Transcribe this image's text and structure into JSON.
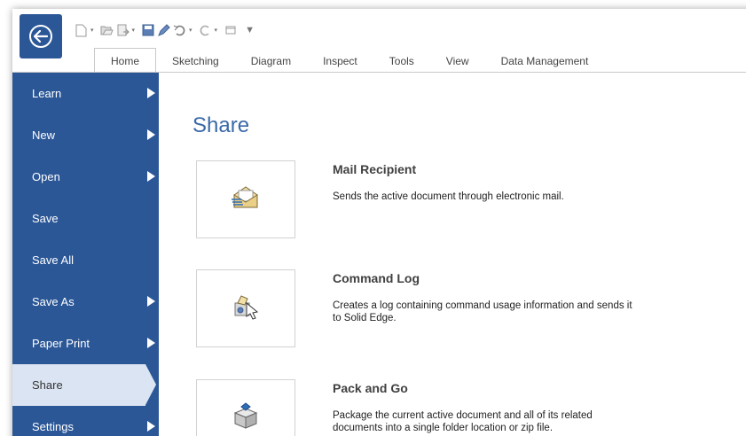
{
  "quick_access": {
    "icons": [
      "new-icon",
      "open-icon",
      "send-icon",
      "save-icon",
      "edit-icon",
      "undo-icon",
      "redo-icon",
      "window-icon",
      "customize-icon"
    ]
  },
  "ribbon": {
    "tabs": [
      {
        "label": "Home",
        "active": true
      },
      {
        "label": "Sketching",
        "active": false
      },
      {
        "label": "Diagram",
        "active": false
      },
      {
        "label": "Inspect",
        "active": false
      },
      {
        "label": "Tools",
        "active": false
      },
      {
        "label": "View",
        "active": false
      },
      {
        "label": "Data Management",
        "active": false
      }
    ]
  },
  "sidebar": {
    "items": [
      {
        "label": "Learn",
        "has_arrow": true
      },
      {
        "label": "New",
        "has_arrow": true
      },
      {
        "label": "Open",
        "has_arrow": true
      },
      {
        "label": "Save",
        "has_arrow": false
      },
      {
        "label": "Save All",
        "has_arrow": false
      },
      {
        "label": "Save As",
        "has_arrow": true
      },
      {
        "label": "Paper Print",
        "has_arrow": true
      },
      {
        "label": "Share",
        "has_arrow": false,
        "active": true
      },
      {
        "label": "Settings",
        "has_arrow": true
      }
    ]
  },
  "main": {
    "title": "Share",
    "options": [
      {
        "title": "Mail Recipient",
        "description": "Sends the active document through electronic mail.",
        "icon": "mail-icon"
      },
      {
        "title": "Command Log",
        "description": "Creates a log containing command usage information and sends it to Solid Edge.",
        "icon": "command-log-icon"
      },
      {
        "title": "Pack and Go",
        "description": "Package the current active document and all of its related documents into a single folder location or zip file.",
        "icon": "pack-and-go-icon"
      }
    ]
  },
  "colors": {
    "sidebar_bg": "#2b5797",
    "sidebar_active_bg": "#dbe4f2",
    "title_blue": "#3a6aa8"
  }
}
